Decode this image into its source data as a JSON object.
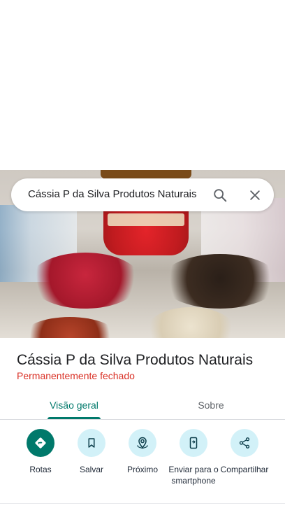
{
  "search": {
    "query": "Cássia P da Silva Produtos Naturais"
  },
  "place": {
    "name": "Cássia P da Silva Produtos Naturais",
    "status": "Permanentemente fechado"
  },
  "tabs": [
    {
      "label": "Visão geral",
      "active": true
    },
    {
      "label": "Sobre",
      "active": false
    }
  ],
  "actions": [
    {
      "label": "Rotas",
      "icon": "directions-icon"
    },
    {
      "label": "Salvar",
      "icon": "bookmark-icon"
    },
    {
      "label": "Próximo",
      "icon": "nearby-icon"
    },
    {
      "label": "Enviar para o smartphone",
      "icon": "send-to-phone-icon"
    },
    {
      "label": "Compartilhar",
      "icon": "share-icon"
    }
  ],
  "colors": {
    "accent": "#00796b",
    "status_closed": "#d93025",
    "action_circle": "#d2f1f8"
  }
}
